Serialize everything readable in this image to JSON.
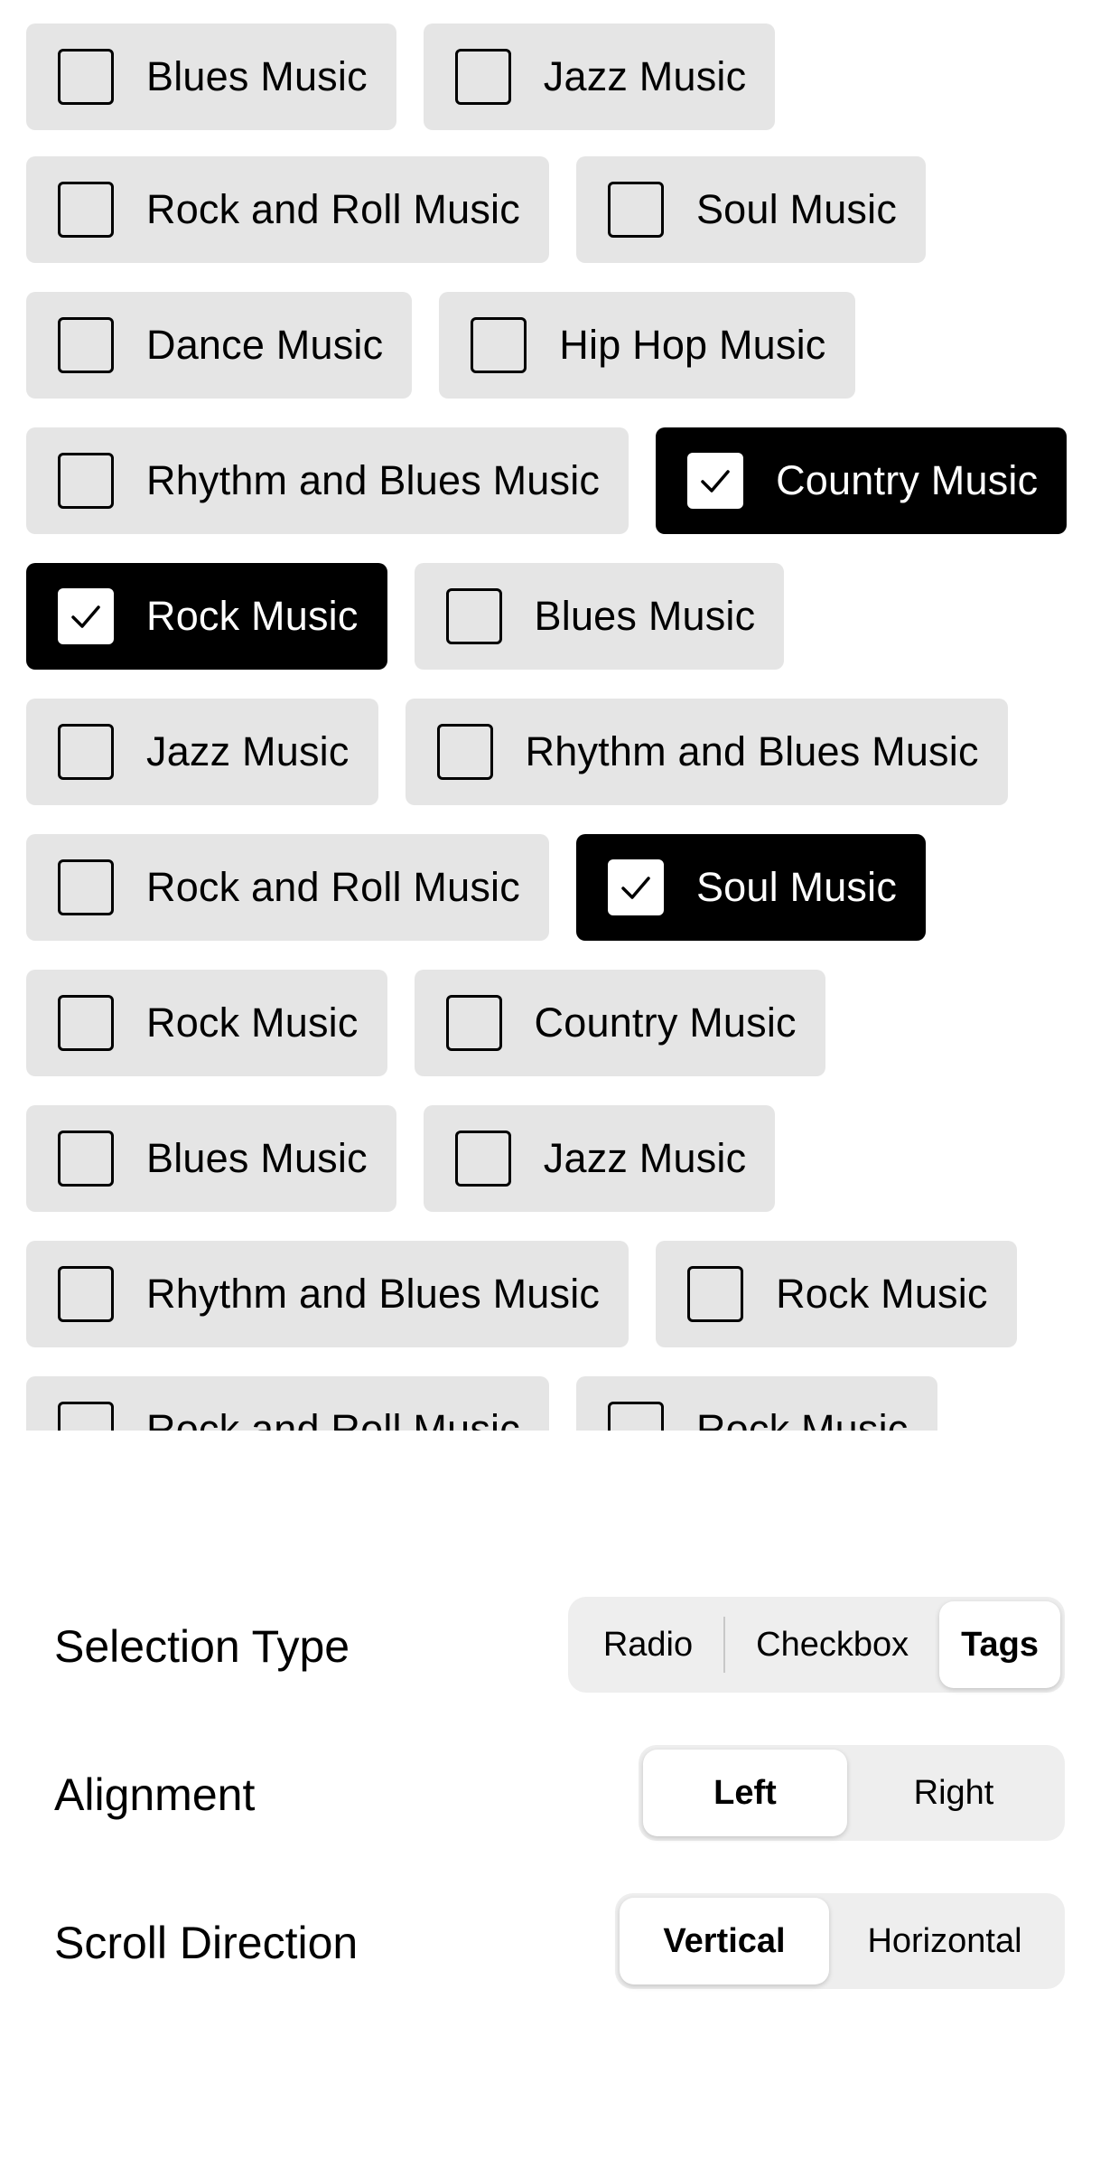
{
  "tag_rows": [
    [
      {
        "label": "Blues Music",
        "selected": false
      },
      {
        "label": "Jazz Music",
        "selected": false
      }
    ],
    [
      {
        "label": "Rock and Roll Music",
        "selected": false
      },
      {
        "label": "Soul Music",
        "selected": false
      }
    ],
    [
      {
        "label": "Dance Music",
        "selected": false
      },
      {
        "label": "Hip Hop Music",
        "selected": false
      }
    ],
    [
      {
        "label": "Rhythm and Blues Music",
        "selected": false
      },
      {
        "label": "Country Music",
        "selected": true
      }
    ],
    [
      {
        "label": "Rock Music",
        "selected": true
      },
      {
        "label": "Blues Music",
        "selected": false
      }
    ],
    [
      {
        "label": "Jazz Music",
        "selected": false
      },
      {
        "label": "Rhythm and Blues Music",
        "selected": false
      }
    ],
    [
      {
        "label": "Rock and Roll Music",
        "selected": false
      },
      {
        "label": "Soul Music",
        "selected": true
      }
    ],
    [
      {
        "label": "Rock Music",
        "selected": false
      },
      {
        "label": "Country Music",
        "selected": false
      }
    ],
    [
      {
        "label": "Blues Music",
        "selected": false
      },
      {
        "label": "Jazz Music",
        "selected": false
      }
    ],
    [
      {
        "label": "Rhythm and Blues Music",
        "selected": false
      },
      {
        "label": "Rock Music",
        "selected": false
      }
    ],
    [
      {
        "label": "Rock and Roll Music",
        "selected": false
      },
      {
        "label": "Rock Music",
        "selected": false
      }
    ]
  ],
  "settings": {
    "selection_type": {
      "label": "Selection Type",
      "options": [
        "Radio",
        "Checkbox",
        "Tags"
      ],
      "selected": "Tags"
    },
    "alignment": {
      "label": "Alignment",
      "options": [
        "Left",
        "Right"
      ],
      "selected": "Left"
    },
    "scroll_direction": {
      "label": "Scroll Direction",
      "options": [
        "Vertical",
        "Horizontal"
      ],
      "selected": "Vertical"
    }
  },
  "colors": {
    "tag_background": "#e5e5e5",
    "tag_selected_background": "#000000",
    "segmented_background": "#eeeeee"
  },
  "icons": {
    "checkbox": "checkbox-icon",
    "check": "checkmark-icon"
  }
}
